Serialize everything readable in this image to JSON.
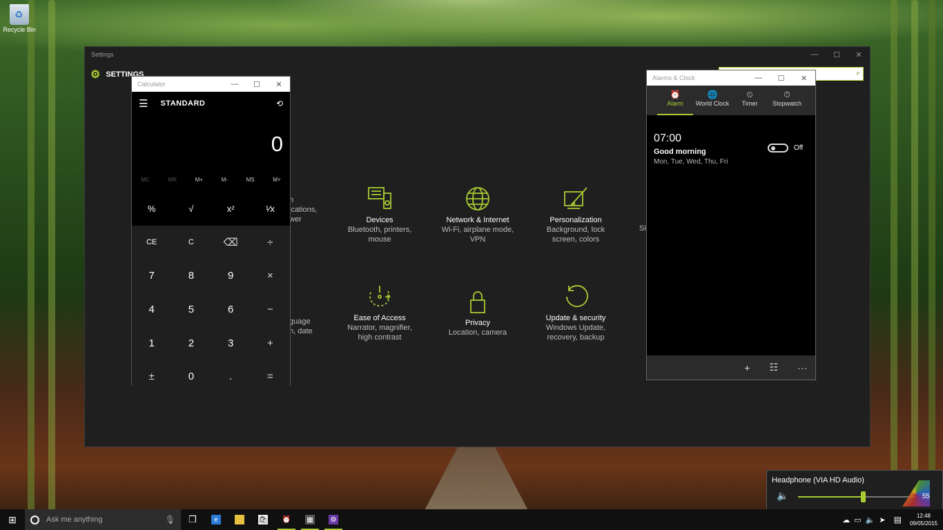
{
  "desktop": {
    "recycle_bin_label": "Recycle Bin"
  },
  "settings": {
    "window_title": "Settings",
    "header": "SETTINGS",
    "tiles": [
      {
        "name": "Devices",
        "sub1": "Bluetooth, printers,",
        "sub2": "mouse",
        "icon": "devices-icon"
      },
      {
        "name": "Network & Internet",
        "sub1": "Wi-Fi, airplane mode,",
        "sub2": "VPN",
        "icon": "globe-icon"
      },
      {
        "name": "Personalization",
        "sub1": "Background, lock",
        "sub2": "screen, colors",
        "icon": "paintbrush-icon"
      },
      {
        "name": "Ease of Access",
        "sub1": "Narrator, magnifier,",
        "sub2": "high contrast",
        "icon": "ease-of-access-icon"
      },
      {
        "name": "Privacy",
        "sub1": "Location, camera",
        "sub2": "",
        "icon": "lock-icon"
      },
      {
        "name": "Update & security",
        "sub1": "Windows Update,",
        "sub2": "recovery, backup",
        "icon": "refresh-icon"
      }
    ],
    "partial": {
      "system_1": "h",
      "system_2": "ications,",
      "system_3": "wer",
      "time_lang_1": "guage",
      "time_lang_2": "n, date",
      "accounts": "Sig"
    }
  },
  "calculator": {
    "title": "Calculator",
    "mode": "STANDARD",
    "display": "0",
    "memory": [
      "MC",
      "MR",
      "M+",
      "M-",
      "MS",
      "M˅"
    ],
    "sci": [
      "%",
      "√",
      "x²",
      "¹⁄x"
    ],
    "keys": [
      "CE",
      "C",
      "⌫",
      "÷",
      "7",
      "8",
      "9",
      "×",
      "4",
      "5",
      "6",
      "−",
      "1",
      "2",
      "3",
      "+",
      "±",
      "0",
      ".",
      "="
    ]
  },
  "alarms": {
    "title": "Alarms & Clock",
    "tabs": [
      {
        "label": "Alarm",
        "icon": "alarm-icon"
      },
      {
        "label": "World Clock",
        "icon": "world-clock-icon"
      },
      {
        "label": "Timer",
        "icon": "timer-icon"
      },
      {
        "label": "Stopwatch",
        "icon": "stopwatch-icon"
      }
    ],
    "alarm": {
      "time": "07:00",
      "name": "Good morning",
      "days": "Mon, Tue, Wed, Thu, Fri",
      "state": "Off"
    },
    "bottom": {
      "add": "+",
      "select": "☷",
      "more": "···"
    }
  },
  "volume": {
    "device": "Headphone (VIA HD Audio)",
    "level": 55
  },
  "taskbar": {
    "search_placeholder": "Ask me anything",
    "time": "12:48",
    "date": "09/05/2015"
  },
  "colors": {
    "accent": "#aacc33"
  }
}
